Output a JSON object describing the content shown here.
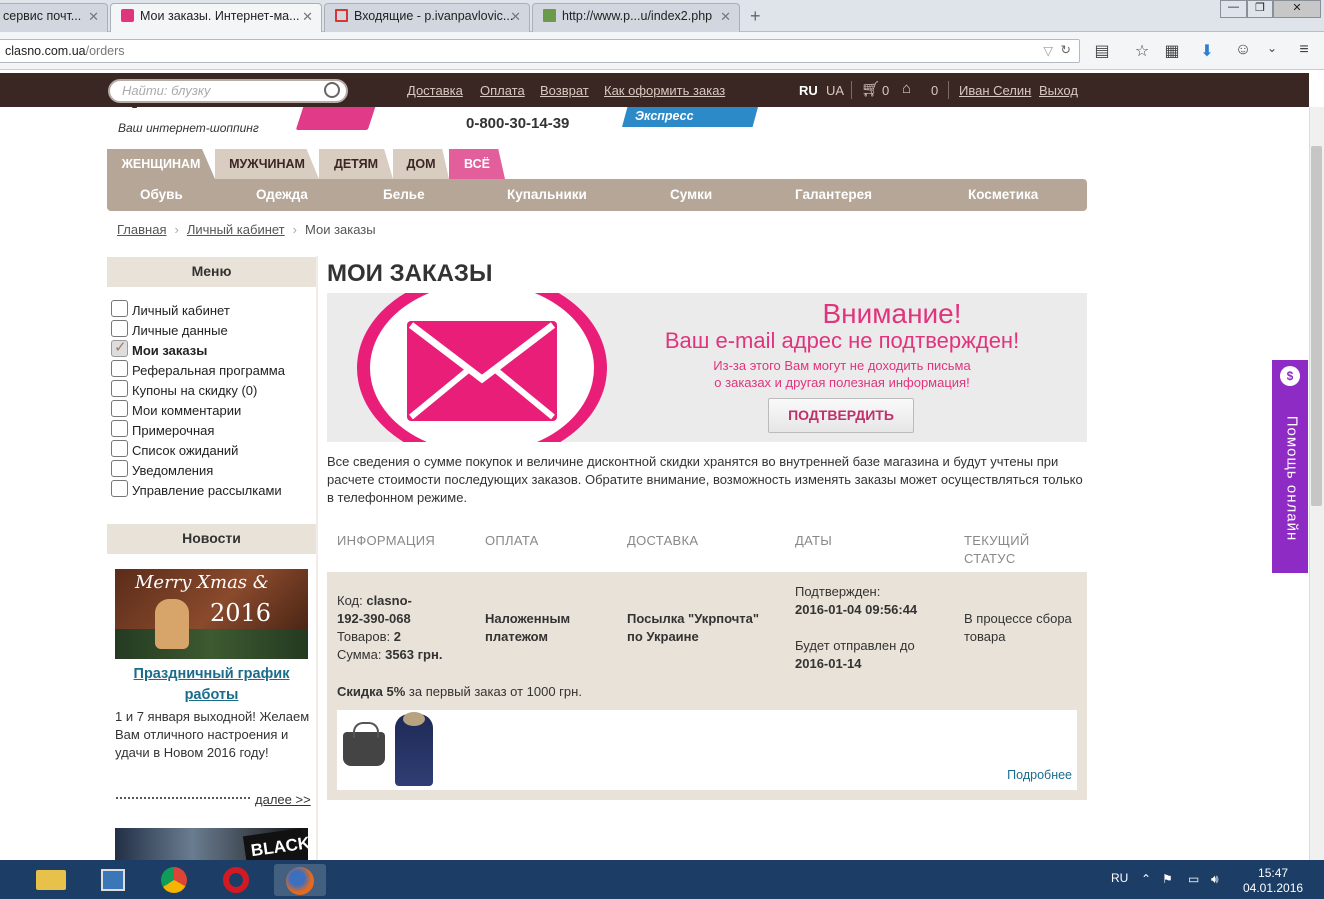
{
  "browser": {
    "tabs": [
      {
        "label": "сервис почт..."
      },
      {
        "label": "Мои заказы. Интернет-ма..."
      },
      {
        "label": "Входящие - p.ivanpavlovic..."
      },
      {
        "label": "http://www.p...u/index2.php"
      }
    ],
    "new_tab": "+",
    "url_host": "clasno.com.ua",
    "url_path": "/orders"
  },
  "site": {
    "search_placeholder": "Найти: блузку",
    "top_links": [
      "Доставка",
      "Оплата",
      "Возврат",
      "Как оформить заказ"
    ],
    "lang_ru": "RU",
    "lang_ua": "UA",
    "cart_count": "0",
    "wish_count": "0",
    "user_name": "Иван Селин",
    "logout": "Выход",
    "logo_text": "clasno",
    "tagline": "Ваш интернет-шоппинг",
    "phone": "0-800-30-14-39",
    "express": "Экспресс отправка",
    "categories": [
      "ЖЕНЩИНАМ",
      "МУЖЧИНАМ",
      "ДЕТЯМ",
      "ДОМ",
      "ВСЁ"
    ],
    "subcategories": [
      "Обувь",
      "Одежда",
      "Белье",
      "Купальники",
      "Сумки",
      "Галантерея",
      "Косметика"
    ]
  },
  "breadcrumb": {
    "home": "Главная",
    "cabinet": "Личный кабинет",
    "current": "Мои заказы"
  },
  "sidebar": {
    "menu_title": "Меню",
    "items": [
      {
        "label": "Личный кабинет",
        "checked": false
      },
      {
        "label": "Личные данные",
        "checked": false
      },
      {
        "label": "Мои заказы",
        "checked": true
      },
      {
        "label": "Реферальная программа",
        "checked": false
      },
      {
        "label": "Купоны на скидку (0)",
        "checked": false
      },
      {
        "label": "Мои комментарии",
        "checked": false
      },
      {
        "label": "Примерочная",
        "checked": false
      },
      {
        "label": "Список ожиданий",
        "checked": false
      },
      {
        "label": "Уведомления",
        "checked": false
      },
      {
        "label": "Управление рассылками",
        "checked": false
      }
    ],
    "news_title": "Новости",
    "news_image_line1": "Merry Xmas &",
    "news_image_line2": "2016",
    "news_link": "Праздничный график работы",
    "news_text": "1 и 7 января выходной! Желаем Вам отличного настроения и удачи в Новом 2016 году!",
    "news_more": "далее >>",
    "news_image2_text": "BLACK"
  },
  "main": {
    "title": "МОИ ЗАКАЗЫ",
    "banner": {
      "line1": "Внимание!",
      "line2": "Ваш e-mail адрес не подтвержден!",
      "line3": "Из-за этого Вам могут не доходить письма",
      "line4": "о заказах и другая полезная информация!",
      "button": "ПОДТВЕРДИТЬ"
    },
    "info": "Все сведения о сумме покупок и величине дисконтной скидки хранятся во внутренней базе магазина и будут учтены при расчете стоимости последующих заказов. Обратите внимание, возможность изменять заказы может осуществляться только в телефонном режиме.",
    "columns": [
      "ИНФОРМАЦИЯ",
      "ОПЛАТА",
      "ДОСТАВКА",
      "ДАТЫ",
      "ТЕКУЩИЙ СТАТУС"
    ],
    "order": {
      "code_label": "Код:",
      "code_part1": "clasno-",
      "code_part2": "192-390-068",
      "items_label": "Товаров:",
      "items": "2",
      "sum_label": "Сумма:",
      "sum": "3563 грн.",
      "payment": "Наложенным платежом",
      "delivery": "Посылка \"Укрпочта\" по Украине",
      "confirmed_label": "Подтвержден:",
      "confirmed": "2016-01-04 09:56:44",
      "ship_label": "Будет отправлен до",
      "ship": "2016-01-14",
      "status": "В процессе сбора товара",
      "discount_bold": "Скидка 5%",
      "discount_rest": " за первый заказ от 1000 грн.",
      "more": "Подробнее"
    }
  },
  "help_widget": "Помощь онлайн",
  "taskbar": {
    "lang": "RU",
    "time": "15:47",
    "date": "04.01.2016"
  },
  "colors": {
    "brand_pink": "#e0357e",
    "header_brown": "#3a2724",
    "beige": "#e9e2d8",
    "help_purple": "#8e2bc4"
  }
}
